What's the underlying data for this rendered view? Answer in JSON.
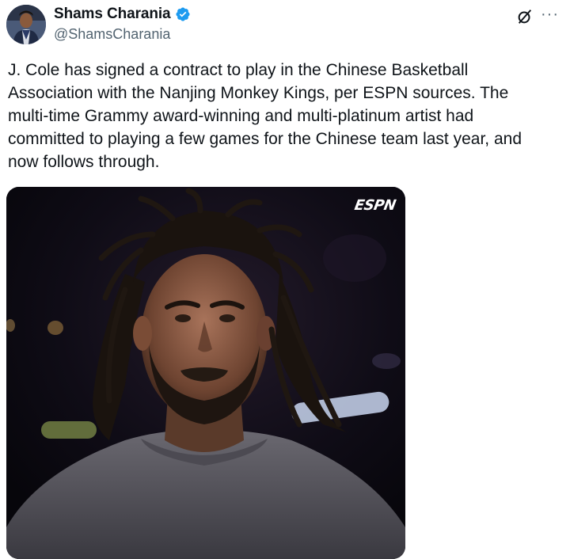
{
  "author": {
    "display_name": "Shams Charania",
    "handle": "@ShamsCharania",
    "verified": true
  },
  "header_icons": {
    "grok": "grok-icon",
    "more": "···"
  },
  "tweet": {
    "text": "J. Cole has signed a contract to play in the Chinese Basketball\nAssociation with the Nanjing Monkey Kings, per ESPN sources. The\nmulti-time Grammy award-winning and multi-platinum artist had\ncommitted to playing a few games for the Chinese team last year, and\nnow follows through."
  },
  "media": {
    "watermark": "ESPN"
  },
  "colors": {
    "text": "#0f1419",
    "secondary": "#536471",
    "verified_blue": "#1d9bf0"
  }
}
